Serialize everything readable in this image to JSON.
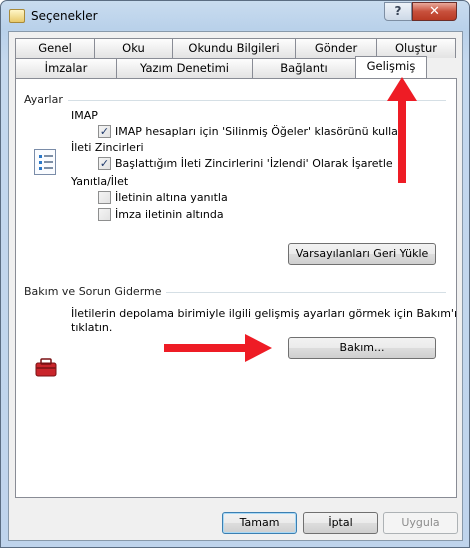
{
  "window": {
    "title": "Seçenekler",
    "help_label": "?",
    "close_label": "✕"
  },
  "tabs": {
    "row1": [
      "Genel",
      "Oku",
      "Okundu Bilgileri",
      "Gönder",
      "Oluştur"
    ],
    "row2": [
      "İmzalar",
      "Yazım Denetimi",
      "Bağlantı",
      "Gelişmiş"
    ],
    "active": "Gelişmiş"
  },
  "settings_section": {
    "title": "Ayarlar",
    "imap_heading": "IMAP",
    "imap_checkbox": "IMAP hesapları için 'Silinmiş Öğeler' klasörünü kullan",
    "imap_checked": true,
    "threads_heading": "İleti Zincirleri",
    "threads_checkbox": "Başlattığım İleti Zincirlerini 'İzlendi' Olarak İşaretle",
    "threads_checked": true,
    "reply_heading": "Yanıtla/İlet",
    "reply_below": "İletinin altına yanıtla",
    "reply_below_checked": false,
    "signature_below": "İmza iletinin altında",
    "signature_below_checked": false,
    "restore_button": "Varsayılanları Geri Yükle"
  },
  "maintenance_section": {
    "title": "Bakım ve Sorun Giderme",
    "description_line1": "İletilerin depolama birimiyle ilgili gelişmiş ayarları görmek için Bakım'ı",
    "description_line2": "tıklatın.",
    "maintenance_button": "Bakım..."
  },
  "footer": {
    "ok": "Tamam",
    "cancel": "İptal",
    "apply": "Uygula"
  },
  "colors": {
    "annotation_arrow": "#ee1c25"
  }
}
